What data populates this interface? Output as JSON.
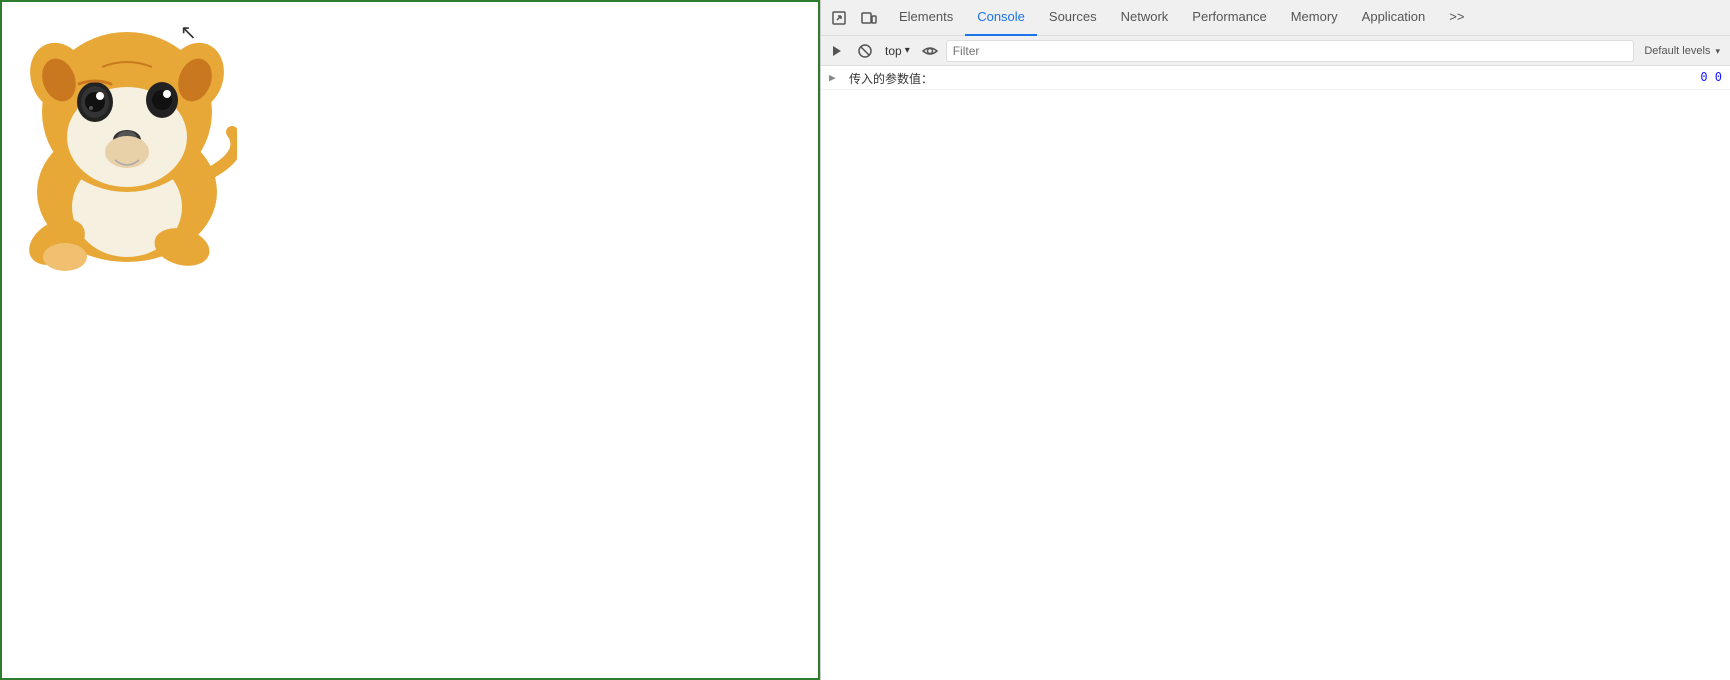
{
  "webpage": {
    "border_color": "#2d7d2d"
  },
  "devtools": {
    "tabs": [
      {
        "id": "elements",
        "label": "Elements",
        "active": false
      },
      {
        "id": "console",
        "label": "Console",
        "active": true
      },
      {
        "id": "sources",
        "label": "Sources",
        "active": false
      },
      {
        "id": "network",
        "label": "Network",
        "active": false
      },
      {
        "id": "performance",
        "label": "Performance",
        "active": false
      },
      {
        "id": "memory",
        "label": "Memory",
        "active": false
      },
      {
        "id": "application",
        "label": "Application",
        "active": false
      }
    ],
    "toolbar": {
      "top_label": "top",
      "filter_placeholder": "Filter",
      "default_levels": "Default levels"
    },
    "console": {
      "log_text": "传入的参数值：",
      "log_numbers": "0 0"
    }
  }
}
